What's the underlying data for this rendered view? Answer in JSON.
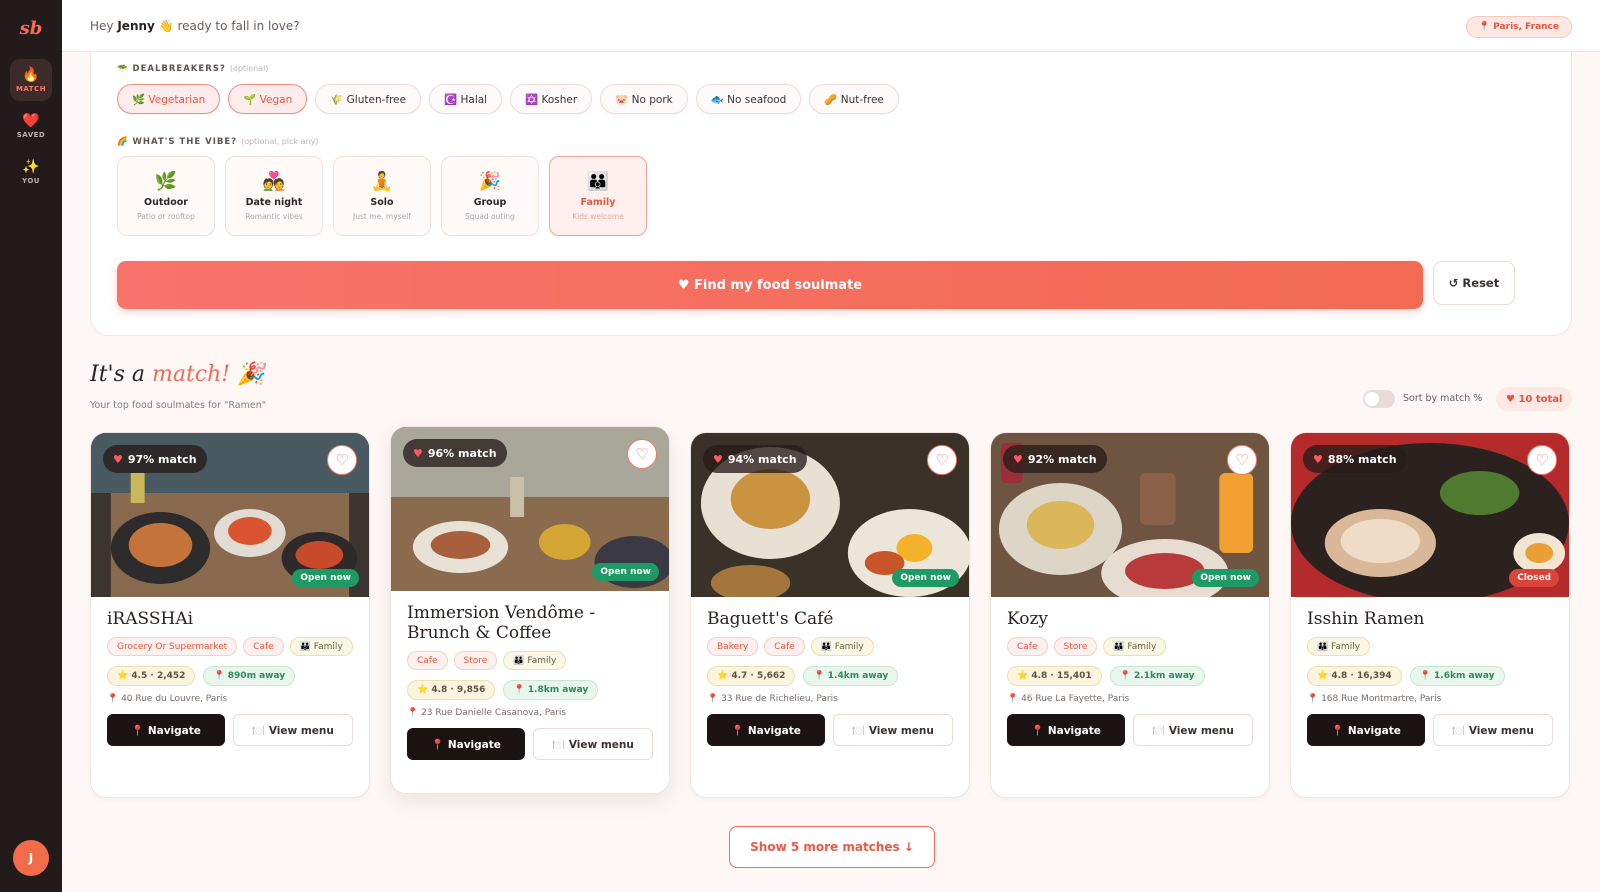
{
  "app": {
    "logo": "sb"
  },
  "sidebar": {
    "items": [
      {
        "icon": "🔥",
        "label": "MATCH"
      },
      {
        "icon": "❤️",
        "label": "SAVED"
      },
      {
        "icon": "✨",
        "label": "YOU"
      }
    ],
    "avatar": "J"
  },
  "header": {
    "greeting_pre": "Hey",
    "name": "Jenny",
    "greeting_post": "👋 ready to fall in love?",
    "location": "📍 Paris, France"
  },
  "filters": {
    "dealbreakers_title": "🥗 DEALBREAKERS?",
    "dealbreakers_optional": "(optional)",
    "chips": [
      {
        "label": "🌿 Vegetarian",
        "selected": true
      },
      {
        "label": "🌱 Vegan",
        "selected": true
      },
      {
        "label": "🌾 Gluten-free",
        "selected": false
      },
      {
        "label": "☪️ Halal",
        "selected": false
      },
      {
        "label": "✡️ Kosher",
        "selected": false
      },
      {
        "label": "🐷 No pork",
        "selected": false
      },
      {
        "label": "🐟 No seafood",
        "selected": false
      },
      {
        "label": "🥜 Nut-free",
        "selected": false
      }
    ],
    "vibe_title": "🌈 WHAT'S THE VIBE?",
    "vibe_optional": "(optional, pick any)",
    "vibes": [
      {
        "icon": "🌿",
        "name": "Outdoor",
        "sub": "Patio or rooftop"
      },
      {
        "icon": "💑",
        "name": "Date night",
        "sub": "Romantic vibes"
      },
      {
        "icon": "🧘",
        "name": "Solo",
        "sub": "Just me, myself"
      },
      {
        "icon": "🎉",
        "name": "Group",
        "sub": "Squad outing"
      },
      {
        "icon": "👪",
        "name": "Family",
        "sub": "Kids welcome",
        "selected": true
      }
    ],
    "find_label": "♥ Find my food soulmate",
    "reset_label": "↺ Reset"
  },
  "results": {
    "title_pre": "It's a",
    "title_accent": "match!",
    "title_emoji": "🎉",
    "subtitle": "Your top food soulmates for \"Ramen\"",
    "sort_label": "Sort by match %",
    "sort_on": false,
    "total": "♥ 10 total",
    "more_label": "Show 5 more matches ↓",
    "cards": [
      {
        "match": "97% match",
        "status": "Open now",
        "status_type": "open",
        "name": "iRASSHAi",
        "tags": [
          "Grocery Or Supermarket",
          "Cafe"
        ],
        "family": "👪 Family",
        "rating": "⭐ 4.5 · 2,452",
        "distance": "📍 890m away",
        "address": "📍 40 Rue du Louvre, Paris",
        "navigate": "📍 Navigate",
        "menu": "🍽️ View menu"
      },
      {
        "match": "96% match",
        "status": "Open now",
        "status_type": "open",
        "name": "Immersion Vendôme - Brunch & Coffee",
        "tags": [
          "Cafe",
          "Store"
        ],
        "family": "👪 Family",
        "rating": "⭐ 4.8 · 9,856",
        "distance": "📍 1.8km away",
        "address": "📍 23 Rue Danielle Casanova, Paris",
        "navigate": "📍 Navigate",
        "menu": "🍽️ View menu"
      },
      {
        "match": "94% match",
        "status": "Open now",
        "status_type": "open",
        "name": "Baguett's Café",
        "tags": [
          "Bakery",
          "Cafe"
        ],
        "family": "👪 Family",
        "rating": "⭐ 4.7 · 5,662",
        "distance": "📍 1.4km away",
        "address": "📍 33 Rue de Richelieu, Paris",
        "navigate": "📍 Navigate",
        "menu": "🍽️ View menu"
      },
      {
        "match": "92% match",
        "status": "Open now",
        "status_type": "open",
        "name": "Kozy",
        "tags": [
          "Cafe",
          "Store"
        ],
        "family": "👪 Family",
        "rating": "⭐ 4.8 · 15,401",
        "distance": "📍 2.1km away",
        "address": "📍 46 Rue La Fayette, Paris",
        "navigate": "📍 Navigate",
        "menu": "🍽️ View menu"
      },
      {
        "match": "88% match",
        "status": "Closed",
        "status_type": "closed",
        "name": "Isshin Ramen",
        "tags": [],
        "family": "👪 Family",
        "rating": "⭐ 4.8 · 16,394",
        "distance": "📍 1.6km away",
        "address": "📍 168 Rue Montmartre, Paris",
        "navigate": "📍 Navigate",
        "menu": "🍽️ View menu"
      }
    ]
  },
  "colors": {
    "accent": "#f26a5a",
    "sidebar": "#231b1b",
    "open": "#1f9a66",
    "closed": "#d9453b"
  }
}
